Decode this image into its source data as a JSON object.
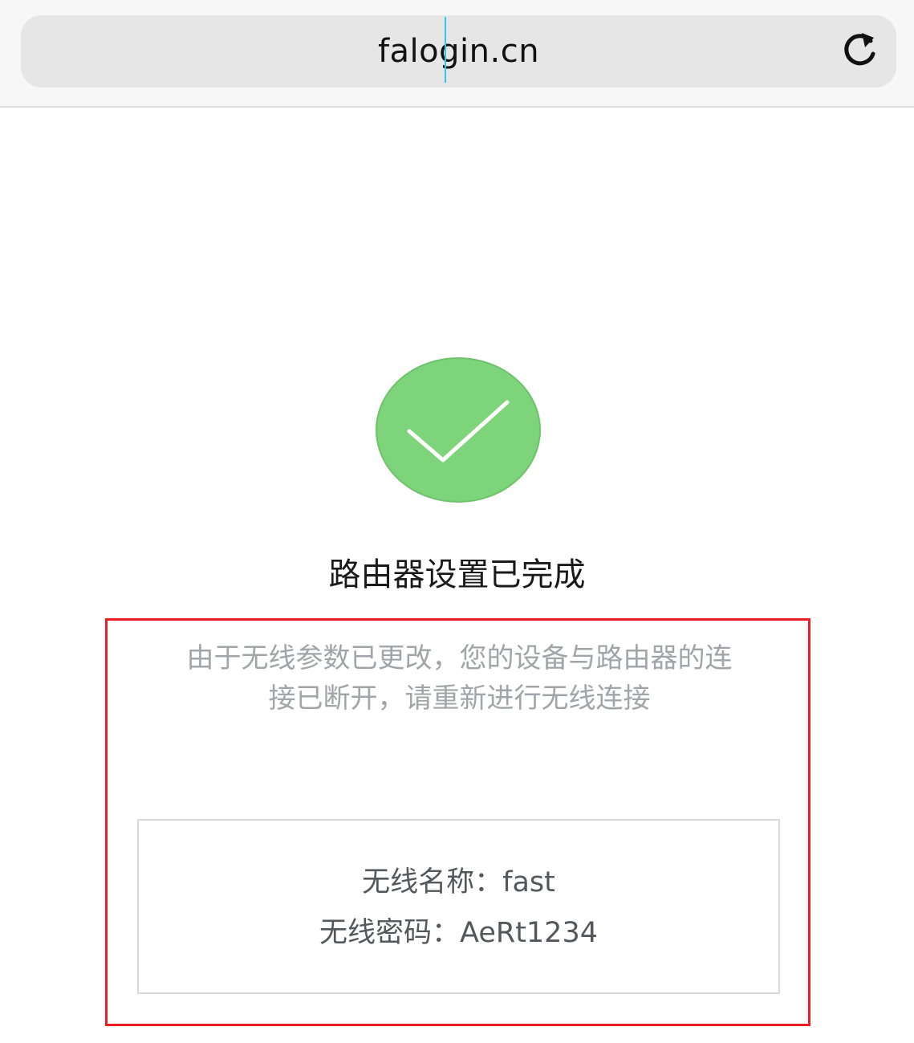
{
  "browser": {
    "url": "falogin.cn",
    "reload_icon": "reload-icon"
  },
  "status": {
    "icon": "checkmark-icon",
    "icon_color": "#7ed47b",
    "title": "路由器设置已完成"
  },
  "notice": {
    "line1": "由于无线参数已更改，您的设备与路由器的连",
    "line2": "接已断开，请重新进行无线连接"
  },
  "credentials": {
    "name_label": "无线名称：",
    "name_value": "fast",
    "password_label": "无线密码：",
    "password_value": "AeRt1234"
  },
  "colors": {
    "highlight_border": "#ee1c24",
    "notice_text": "#a2a4a9",
    "credential_text": "#55575c"
  }
}
